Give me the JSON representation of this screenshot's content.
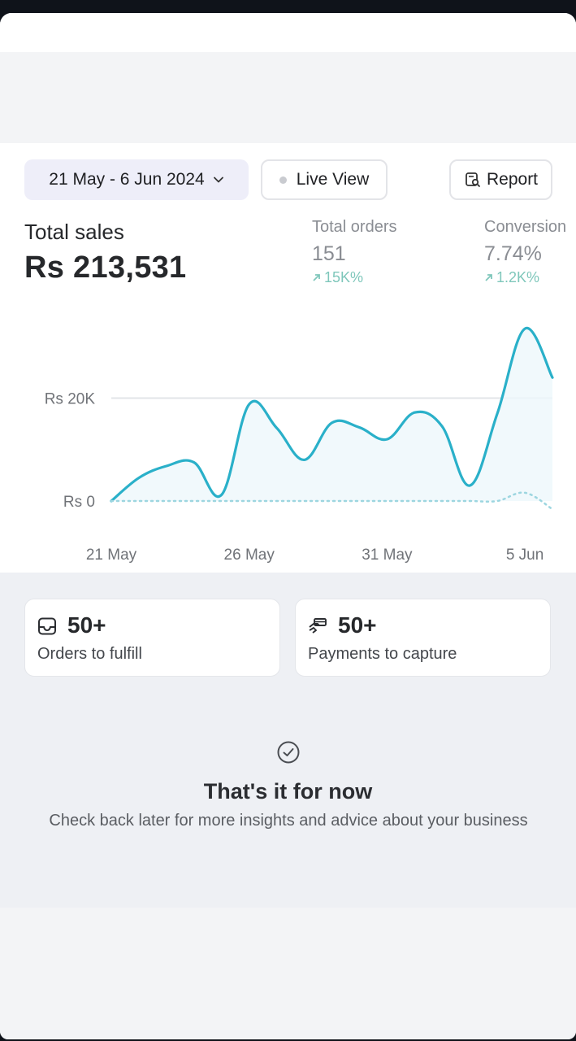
{
  "toolbar": {
    "date_range": "21 May - 6 Jun 2024",
    "live_view": "Live View",
    "report": "Report"
  },
  "summary": {
    "total_sales_label": "Total sales",
    "total_sales_value": "Rs 213,531",
    "metrics": [
      {
        "label": "Total orders",
        "value": "151",
        "change": "15K%"
      },
      {
        "label": "Conversion",
        "value": "7.74%",
        "change": "1.2K%"
      }
    ]
  },
  "chart_data": {
    "type": "line",
    "ytick_labels": [
      "Rs 20K",
      "Rs 0"
    ],
    "ylim": [
      0,
      34000
    ],
    "xtick_labels": [
      "21 May",
      "26 May",
      "31 May",
      "5 Jun"
    ],
    "x": [
      "21 May",
      "22 May",
      "23 May",
      "24 May",
      "25 May",
      "26 May",
      "27 May",
      "28 May",
      "29 May",
      "30 May",
      "31 May",
      "1 Jun",
      "2 Jun",
      "3 Jun",
      "4 Jun",
      "5 Jun",
      "6 Jun"
    ],
    "series": [
      {
        "values": [
          0,
          4500,
          6800,
          7500,
          1200,
          18800,
          14200,
          8000,
          15200,
          14300,
          12000,
          17200,
          14500,
          3000,
          17000,
          33500,
          24000
        ],
        "style": "solid",
        "color": "#2ab0c9"
      },
      {
        "values": [
          0,
          0,
          0,
          0,
          0,
          0,
          0,
          0,
          0,
          0,
          0,
          0,
          0,
          0,
          0,
          1600,
          -1600
        ],
        "style": "dotted",
        "color": "#9dd6e0"
      }
    ],
    "grid": true
  },
  "cards": [
    {
      "icon": "inbox-icon",
      "count": "50+",
      "label": "Orders to fulfill"
    },
    {
      "icon": "payment-hand-icon",
      "count": "50+",
      "label": "Payments to capture"
    }
  ],
  "empty_state": {
    "icon": "check-circle-icon",
    "title": "That's it for now",
    "text": "Check back later for more insights and advice about your business"
  },
  "colors": {
    "accent_line": "#2ab0c9",
    "positive_change": "#7fc7bb",
    "date_pill_bg": "#eeeef9"
  }
}
